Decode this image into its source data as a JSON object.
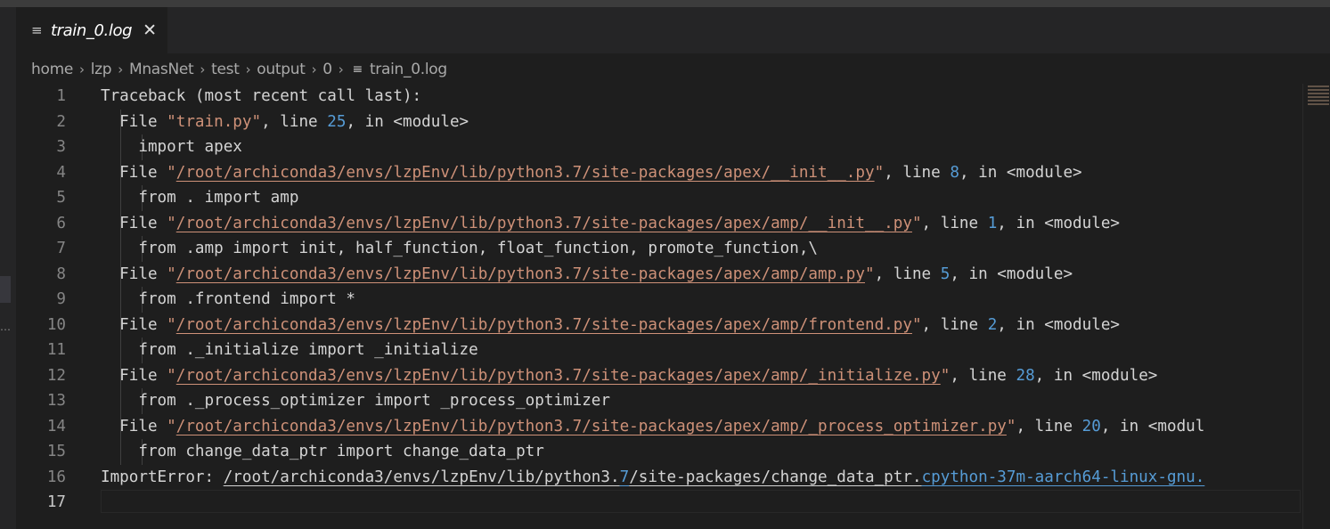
{
  "tab": {
    "file_icon": "file-lines-icon",
    "name": "train_0.log",
    "close": "✕"
  },
  "breadcrumb": {
    "parts": [
      "home",
      "lzp",
      "MnasNet",
      "test",
      "output",
      "0"
    ],
    "separator": "›",
    "file": "train_0.log"
  },
  "editor": {
    "current_line": 17,
    "lines": [
      {
        "n": "1",
        "segs": [
          {
            "t": "Traceback (most recent call last):"
          }
        ]
      },
      {
        "n": "2",
        "segs": [
          {
            "t": "  File "
          },
          {
            "t": "\"train.py\"",
            "c": "str"
          },
          {
            "t": ", line "
          },
          {
            "t": "25",
            "c": "num"
          },
          {
            "t": ", in <module>"
          }
        ]
      },
      {
        "n": "3",
        "segs": [
          {
            "t": "    import apex"
          }
        ]
      },
      {
        "n": "4",
        "segs": [
          {
            "t": "  File "
          },
          {
            "t": "\"",
            "c": "str"
          },
          {
            "t": "/root/archiconda3/envs/lzpEnv/lib/python3.7/site-packages/apex/__init__.py",
            "c": "str path"
          },
          {
            "t": "\"",
            "c": "str"
          },
          {
            "t": ", line "
          },
          {
            "t": "8",
            "c": "num"
          },
          {
            "t": ", in <module>"
          }
        ]
      },
      {
        "n": "5",
        "segs": [
          {
            "t": "    from . import amp"
          }
        ]
      },
      {
        "n": "6",
        "segs": [
          {
            "t": "  File "
          },
          {
            "t": "\"",
            "c": "str"
          },
          {
            "t": "/root/archiconda3/envs/lzpEnv/lib/python3.7/site-packages/apex/amp/__init__.py",
            "c": "str path"
          },
          {
            "t": "\"",
            "c": "str"
          },
          {
            "t": ", line "
          },
          {
            "t": "1",
            "c": "num"
          },
          {
            "t": ", in <module>"
          }
        ]
      },
      {
        "n": "7",
        "segs": [
          {
            "t": "    from .amp import init, half_function, float_function, promote_function,\\"
          }
        ]
      },
      {
        "n": "8",
        "segs": [
          {
            "t": "  File "
          },
          {
            "t": "\"",
            "c": "str"
          },
          {
            "t": "/root/archiconda3/envs/lzpEnv/lib/python3.7/site-packages/apex/amp/amp.py",
            "c": "str path"
          },
          {
            "t": "\"",
            "c": "str"
          },
          {
            "t": ", line "
          },
          {
            "t": "5",
            "c": "num"
          },
          {
            "t": ", in <module>"
          }
        ]
      },
      {
        "n": "9",
        "segs": [
          {
            "t": "    from .frontend import *"
          }
        ]
      },
      {
        "n": "10",
        "segs": [
          {
            "t": "  File "
          },
          {
            "t": "\"",
            "c": "str"
          },
          {
            "t": "/root/archiconda3/envs/lzpEnv/lib/python3.7/site-packages/apex/amp/frontend.py",
            "c": "str path"
          },
          {
            "t": "\"",
            "c": "str"
          },
          {
            "t": ", line "
          },
          {
            "t": "2",
            "c": "num"
          },
          {
            "t": ", in <module>"
          }
        ]
      },
      {
        "n": "11",
        "segs": [
          {
            "t": "    from ._initialize import _initialize"
          }
        ]
      },
      {
        "n": "12",
        "segs": [
          {
            "t": "  File "
          },
          {
            "t": "\"",
            "c": "str"
          },
          {
            "t": "/root/archiconda3/envs/lzpEnv/lib/python3.7/site-packages/apex/amp/_initialize.py",
            "c": "str path"
          },
          {
            "t": "\"",
            "c": "str"
          },
          {
            "t": ", line "
          },
          {
            "t": "28",
            "c": "num"
          },
          {
            "t": ", in <module>"
          }
        ]
      },
      {
        "n": "13",
        "segs": [
          {
            "t": "    from ._process_optimizer import _process_optimizer"
          }
        ]
      },
      {
        "n": "14",
        "segs": [
          {
            "t": "  File "
          },
          {
            "t": "\"",
            "c": "str"
          },
          {
            "t": "/root/archiconda3/envs/lzpEnv/lib/python3.7/site-packages/apex/amp/_process_optimizer.py",
            "c": "str path"
          },
          {
            "t": "\"",
            "c": "str"
          },
          {
            "t": ", line "
          },
          {
            "t": "20",
            "c": "num"
          },
          {
            "t": ", in <modul"
          }
        ]
      },
      {
        "n": "15",
        "segs": [
          {
            "t": "    from change_data_ptr import change_data_ptr"
          }
        ]
      },
      {
        "n": "16",
        "segs": [
          {
            "t": "ImportError: "
          },
          {
            "t": "/root/archiconda3/envs/lzpEnv/lib/python3.",
            "c": "pathw"
          },
          {
            "t": "7",
            "c": "blue"
          },
          {
            "t": "/site-packages/change_data_ptr.",
            "c": "pathw"
          },
          {
            "t": "cpython-37m-aarch64-linux-gnu.",
            "c": "blue"
          }
        ]
      },
      {
        "n": "17",
        "segs": []
      }
    ]
  }
}
